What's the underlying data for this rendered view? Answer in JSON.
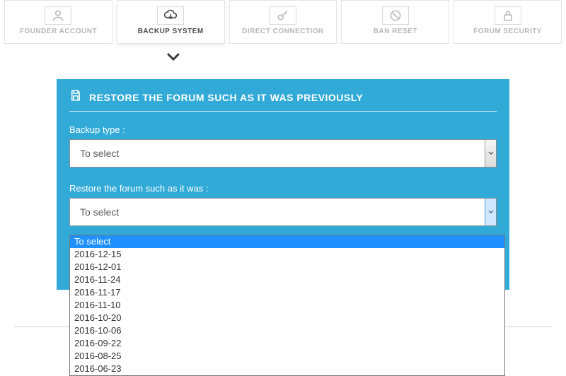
{
  "tabs": [
    {
      "label": "FOUNDER ACCOUNT"
    },
    {
      "label": "BACKUP SYSTEM"
    },
    {
      "label": "DIRECT CONNECTION"
    },
    {
      "label": "BAN RESET"
    },
    {
      "label": "FORUM SECURITY"
    }
  ],
  "panel": {
    "title": "RESTORE THE FORUM SUCH AS IT WAS PREVIOUSLY",
    "backup_type_label": "Backup type :",
    "backup_type_value": "To select",
    "restore_label": "Restore the forum such as it was :",
    "restore_value": "To select"
  },
  "dropdown": {
    "options": [
      "To select",
      "2016-12-15",
      "2016-12-01",
      "2016-11-24",
      "2016-11-17",
      "2016-11-10",
      "2016-10-20",
      "2016-10-06",
      "2016-09-22",
      "2016-08-25",
      "2016-06-23"
    ]
  }
}
